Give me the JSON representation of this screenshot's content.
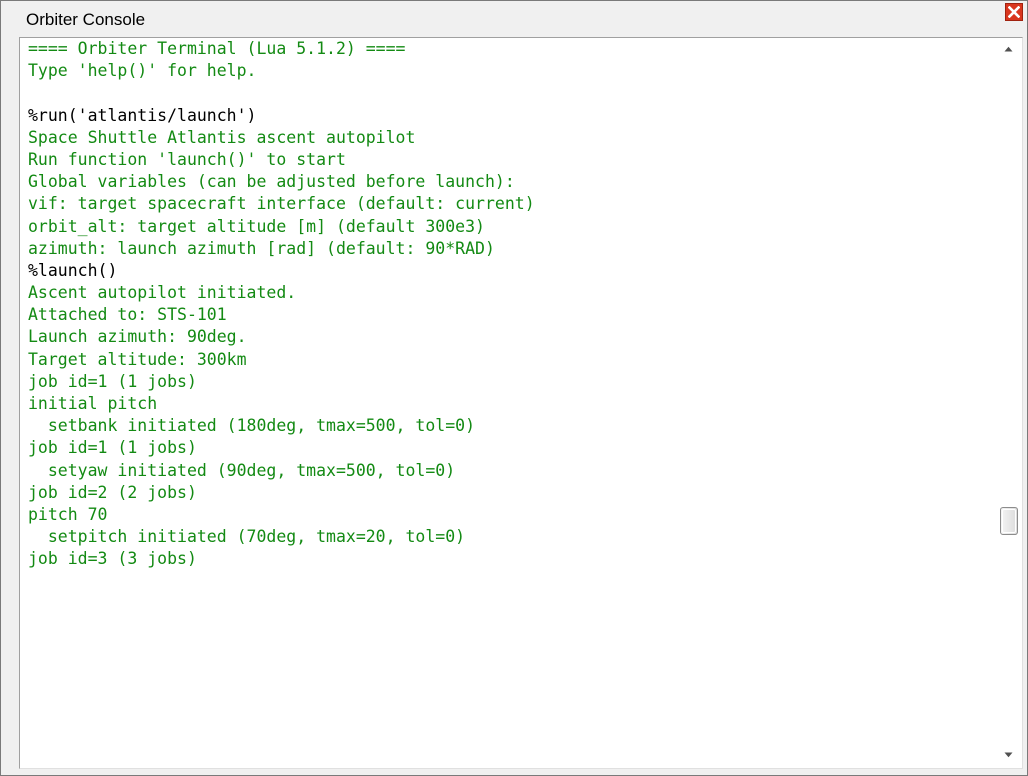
{
  "window": {
    "title": "Orbiter Console"
  },
  "icons": {
    "close": "close-icon",
    "scroll_up": "arrow-up-icon",
    "scroll_down": "arrow-down-icon"
  },
  "colors": {
    "output_text": "#138a13",
    "command_text": "#000000",
    "close_button": "#d9361e"
  },
  "scrollbar": {
    "position_fraction": 0.68
  },
  "console": {
    "lines": [
      {
        "kind": "out",
        "text": "==== Orbiter Terminal (Lua 5.1.2) ===="
      },
      {
        "kind": "out",
        "text": "Type 'help()' for help."
      },
      {
        "kind": "out",
        "text": ""
      },
      {
        "kind": "cmd",
        "text": "%run('atlantis/launch')"
      },
      {
        "kind": "out",
        "text": "Space Shuttle Atlantis ascent autopilot"
      },
      {
        "kind": "out",
        "text": "Run function 'launch()' to start"
      },
      {
        "kind": "out",
        "text": "Global variables (can be adjusted before launch):"
      },
      {
        "kind": "out",
        "text": "vif: target spacecraft interface (default: current)"
      },
      {
        "kind": "out",
        "text": "orbit_alt: target altitude [m] (default 300e3)"
      },
      {
        "kind": "out",
        "text": "azimuth: launch azimuth [rad] (default: 90*RAD)"
      },
      {
        "kind": "cmd",
        "text": "%launch()"
      },
      {
        "kind": "out",
        "text": "Ascent autopilot initiated."
      },
      {
        "kind": "out",
        "text": "Attached to: STS-101"
      },
      {
        "kind": "out",
        "text": "Launch azimuth: 90deg."
      },
      {
        "kind": "out",
        "text": "Target altitude: 300km"
      },
      {
        "kind": "out",
        "text": "job id=1 (1 jobs)"
      },
      {
        "kind": "out",
        "text": "initial pitch"
      },
      {
        "kind": "out",
        "text": "  setbank initiated (180deg, tmax=500, tol=0)"
      },
      {
        "kind": "out",
        "text": "job id=1 (1 jobs)"
      },
      {
        "kind": "out",
        "text": "  setyaw initiated (90deg, tmax=500, tol=0)"
      },
      {
        "kind": "out",
        "text": "job id=2 (2 jobs)"
      },
      {
        "kind": "out",
        "text": "pitch 70"
      },
      {
        "kind": "out",
        "text": "  setpitch initiated (70deg, tmax=20, tol=0)"
      },
      {
        "kind": "out",
        "text": "job id=3 (3 jobs)"
      }
    ]
  }
}
